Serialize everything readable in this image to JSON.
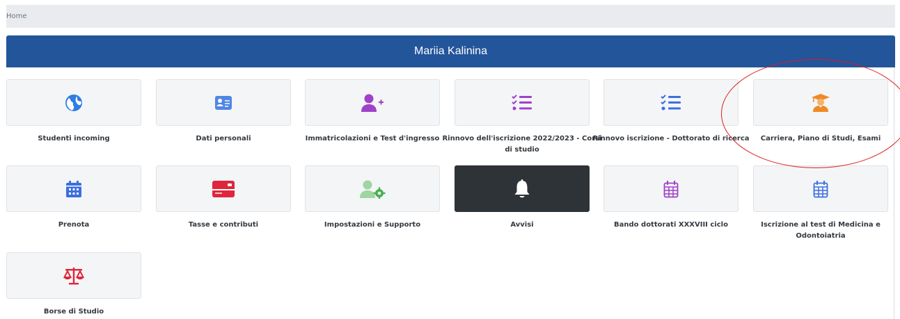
{
  "breadcrumb": {
    "home": "Home"
  },
  "header": {
    "title": "Mariia Kalinina"
  },
  "colors": {
    "header_bg": "#23559b",
    "annotation": "#dd1e1e"
  },
  "tiles": [
    {
      "label": "Studenti incoming",
      "icon": "globe-icon",
      "color": "#2f7de1"
    },
    {
      "label": "Dati personali",
      "icon": "id-card-icon",
      "color": "#4f86e6"
    },
    {
      "label": "Immatricolazioni e Test d'ingresso",
      "icon": "user-plus-icon",
      "color": "#a041c9"
    },
    {
      "label": "Rinnovo dell'iscrizione 2022/2023 - Corsi di studio",
      "icon": "checklist-icon",
      "color": "#a041c9"
    },
    {
      "label": "Rinnovo iscrizione - Dottorato di ricerca",
      "icon": "checklist-icon",
      "color": "#3b6fe0"
    },
    {
      "label": "Carriera, Piano di Studi, Esami",
      "icon": "graduate-icon",
      "color": "#f08a24"
    },
    {
      "label": "Prenota",
      "icon": "calendar-icon",
      "color": "#3b6fe0"
    },
    {
      "label": "Tasse e contributi",
      "icon": "credit-card-icon",
      "color": "#e0263a"
    },
    {
      "label": "Impostazioni e Supporto",
      "icon": "user-gear-icon",
      "color": "#4caf50"
    },
    {
      "label": "Avvisi",
      "icon": "bell-icon",
      "color": "#ffffff"
    },
    {
      "label": "Bando dottorati XXXVIII ciclo",
      "icon": "calendar-grid-icon",
      "color": "#a041c9"
    },
    {
      "label": "Iscrizione al test di Medicina e Odontoiatria",
      "icon": "calendar-grid-icon",
      "color": "#3b6fe0"
    },
    {
      "label": "Borse di Studio",
      "icon": "scales-icon",
      "color": "#e0263a"
    }
  ]
}
